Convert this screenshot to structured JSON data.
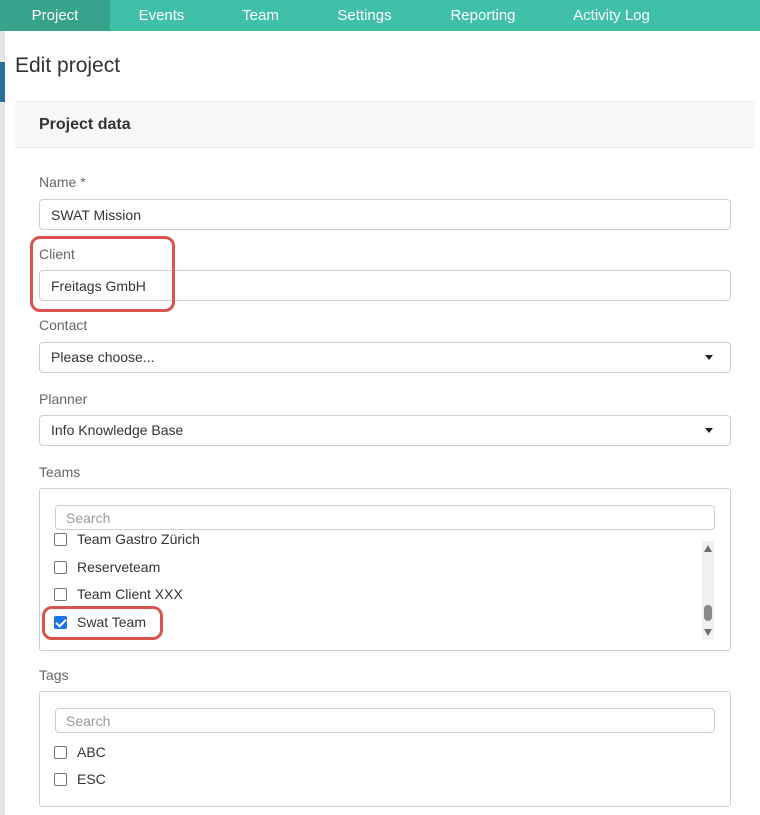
{
  "nav": {
    "tabs": [
      {
        "label": "Project",
        "active": true
      },
      {
        "label": "Events"
      },
      {
        "label": "Team"
      },
      {
        "label": "Settings"
      },
      {
        "label": "Reporting"
      },
      {
        "label": "Activity Log"
      }
    ]
  },
  "page": {
    "title": "Edit project"
  },
  "panel": {
    "title": "Project data"
  },
  "form": {
    "name": {
      "label": "Name *",
      "value": "SWAT Mission"
    },
    "client": {
      "label": "Client",
      "value": "Freitags GmbH"
    },
    "contact": {
      "label": "Contact",
      "value": "Please choose..."
    },
    "planner": {
      "label": "Planner",
      "value": "Info Knowledge Base"
    },
    "teams": {
      "label": "Teams",
      "search_placeholder": "Search",
      "items": [
        {
          "label": "Team Gastro Zürich",
          "checked": false
        },
        {
          "label": "Reserveteam",
          "checked": false
        },
        {
          "label": "Team Client XXX",
          "checked": false
        },
        {
          "label": "Swat Team",
          "checked": true
        }
      ]
    },
    "tags": {
      "label": "Tags",
      "search_placeholder": "Search",
      "items": [
        {
          "label": "ABC",
          "checked": false
        },
        {
          "label": "ESC",
          "checked": false
        }
      ]
    }
  },
  "colors": {
    "nav_bg": "#40c0a8",
    "nav_active": "#38a38d",
    "highlight": "#d9534f",
    "checkbox_checked": "#1a73e8"
  }
}
